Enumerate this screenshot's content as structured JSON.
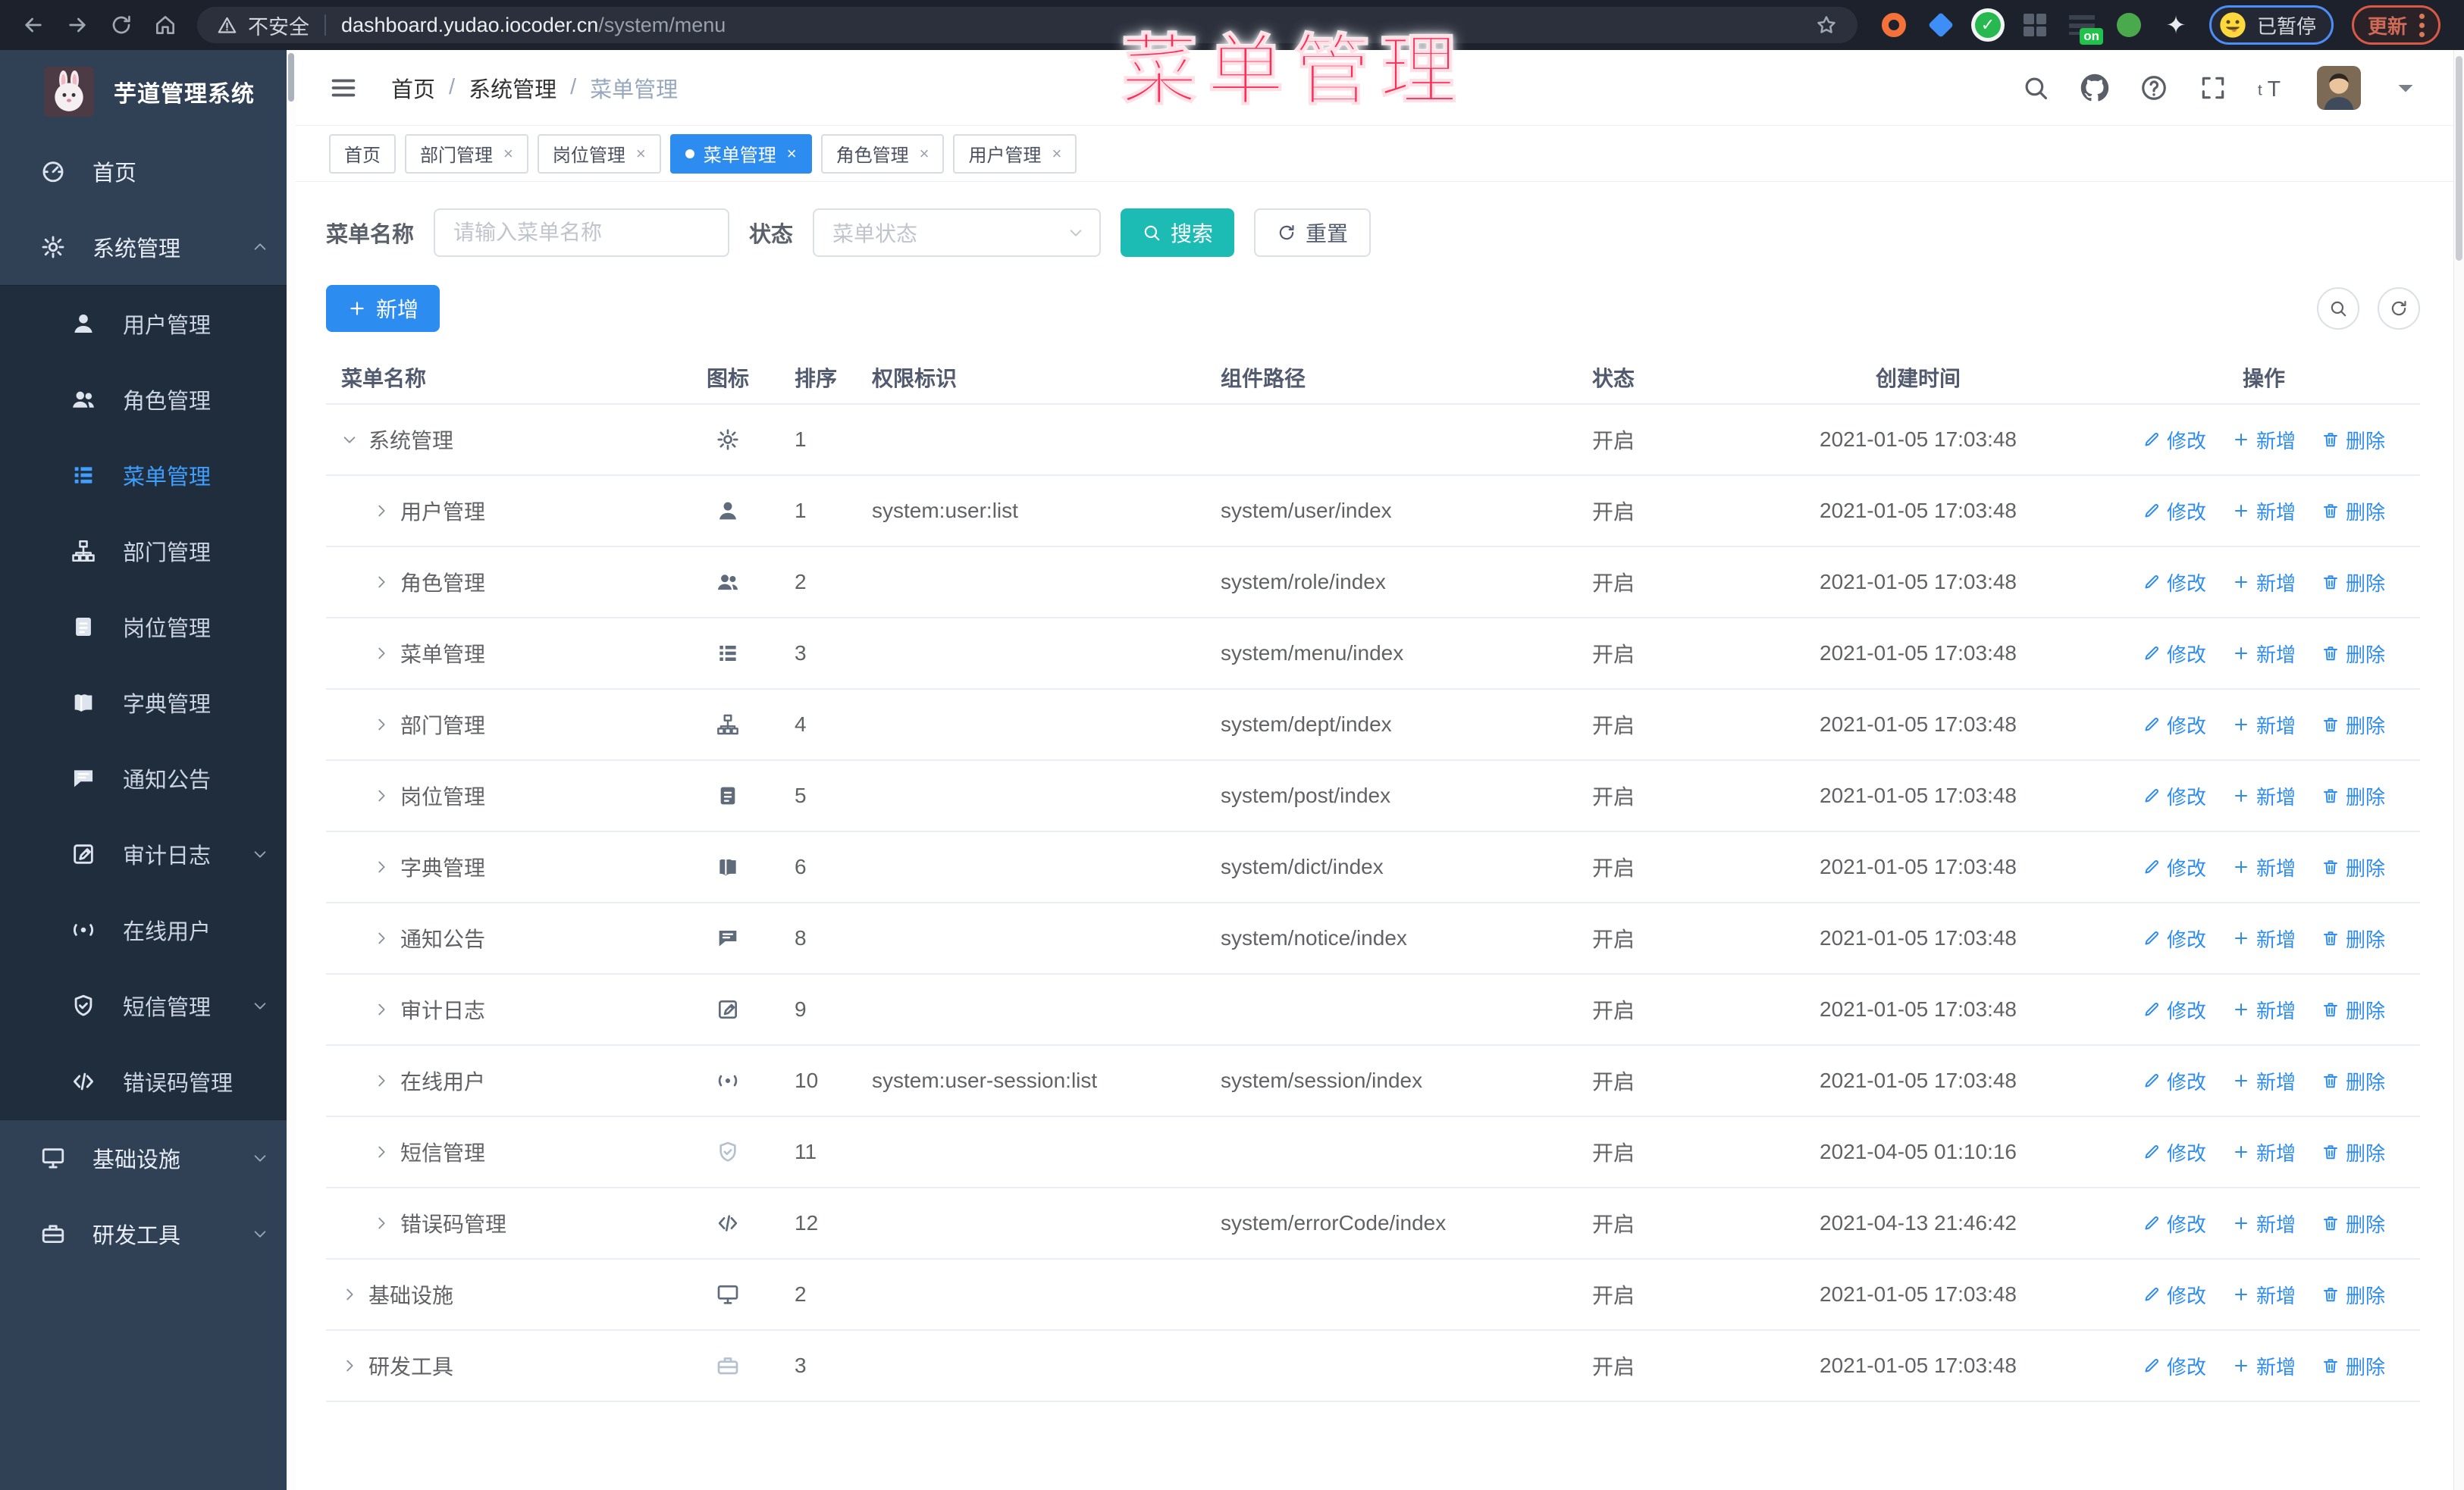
{
  "colors": {
    "accent_blue": "#2d8cf0",
    "link_blue": "#409eff",
    "teal": "#1cbcb4",
    "sidebar_bg": "#304156",
    "submenu_bg": "#1f2d3d",
    "watermark_pink": "#fb2e57",
    "chrome_bg": "#1d212b"
  },
  "watermark": "菜单管理",
  "browser": {
    "security_label": "不安全",
    "url_host": "dashboard.yudao.iocoder.cn",
    "url_path": "/system/menu",
    "extensions": [
      {
        "kind": "ring"
      },
      {
        "kind": "gem"
      },
      {
        "kind": "check"
      },
      {
        "kind": "grid"
      },
      {
        "kind": "bars",
        "badge": "on"
      },
      {
        "kind": "tool"
      },
      {
        "kind": "puzzle"
      }
    ],
    "paused_label": "已暂停",
    "update_label": "更新"
  },
  "sidebar": {
    "title": "芋道管理系统",
    "items": [
      {
        "label": "首页",
        "icon": "dashboard",
        "type": "top"
      },
      {
        "label": "系统管理",
        "icon": "gear",
        "type": "top",
        "arrow": "up"
      },
      {
        "label": "用户管理",
        "icon": "user",
        "type": "sub"
      },
      {
        "label": "角色管理",
        "icon": "users",
        "type": "sub"
      },
      {
        "label": "菜单管理",
        "icon": "menu",
        "type": "sub",
        "active": true
      },
      {
        "label": "部门管理",
        "icon": "tree",
        "type": "sub"
      },
      {
        "label": "岗位管理",
        "icon": "post",
        "type": "sub"
      },
      {
        "label": "字典管理",
        "icon": "dict",
        "type": "sub"
      },
      {
        "label": "通知公告",
        "icon": "notice",
        "type": "sub"
      },
      {
        "label": "审计日志",
        "icon": "audit",
        "type": "sub",
        "arrow": "down"
      },
      {
        "label": "在线用户",
        "icon": "online",
        "type": "sub"
      },
      {
        "label": "短信管理",
        "icon": "sms",
        "type": "sub",
        "arrow": "down"
      },
      {
        "label": "错误码管理",
        "icon": "code",
        "type": "sub"
      },
      {
        "label": "基础设施",
        "icon": "monitor",
        "type": "top",
        "arrow": "down"
      },
      {
        "label": "研发工具",
        "icon": "tool",
        "type": "top",
        "arrow": "down"
      }
    ]
  },
  "navbar": {
    "breadcrumbs": [
      "首页",
      "系统管理",
      "菜单管理"
    ],
    "sep": "/"
  },
  "tabs": [
    {
      "label": "首页"
    },
    {
      "label": "部门管理",
      "closable": true
    },
    {
      "label": "岗位管理",
      "closable": true
    },
    {
      "label": "菜单管理",
      "closable": true,
      "active": true
    },
    {
      "label": "角色管理",
      "closable": true
    },
    {
      "label": "用户管理",
      "closable": true
    }
  ],
  "filters": {
    "name_label": "菜单名称",
    "name_placeholder": "请输入菜单名称",
    "status_label": "状态",
    "status_placeholder": "菜单状态",
    "search_label": "搜索",
    "reset_label": "重置"
  },
  "toolbar": {
    "add_label": "新增"
  },
  "table": {
    "columns": [
      "菜单名称",
      "图标",
      "排序",
      "权限标识",
      "组件路径",
      "状态",
      "创建时间",
      "操作"
    ],
    "action_labels": {
      "edit": "修改",
      "add": "新增",
      "delete": "删除"
    },
    "rows": [
      {
        "name": "系统管理",
        "icon": "gear",
        "level": 0,
        "expanded": true,
        "sort": "1",
        "permission": "",
        "component": "",
        "status": "开启",
        "created": "2021-01-05 17:03:48"
      },
      {
        "name": "用户管理",
        "icon": "user",
        "level": 1,
        "sort": "1",
        "permission": "system:user:list",
        "component": "system/user/index",
        "status": "开启",
        "created": "2021-01-05 17:03:48"
      },
      {
        "name": "角色管理",
        "icon": "users",
        "level": 1,
        "sort": "2",
        "permission": "",
        "component": "system/role/index",
        "status": "开启",
        "created": "2021-01-05 17:03:48"
      },
      {
        "name": "菜单管理",
        "icon": "menu",
        "level": 1,
        "sort": "3",
        "permission": "",
        "component": "system/menu/index",
        "status": "开启",
        "created": "2021-01-05 17:03:48"
      },
      {
        "name": "部门管理",
        "icon": "tree",
        "level": 1,
        "sort": "4",
        "permission": "",
        "component": "system/dept/index",
        "status": "开启",
        "created": "2021-01-05 17:03:48"
      },
      {
        "name": "岗位管理",
        "icon": "post",
        "level": 1,
        "sort": "5",
        "permission": "",
        "component": "system/post/index",
        "status": "开启",
        "created": "2021-01-05 17:03:48"
      },
      {
        "name": "字典管理",
        "icon": "dict",
        "level": 1,
        "sort": "6",
        "permission": "",
        "component": "system/dict/index",
        "status": "开启",
        "created": "2021-01-05 17:03:48"
      },
      {
        "name": "通知公告",
        "icon": "notice",
        "level": 1,
        "sort": "8",
        "permission": "",
        "component": "system/notice/index",
        "status": "开启",
        "created": "2021-01-05 17:03:48"
      },
      {
        "name": "审计日志",
        "icon": "audit",
        "level": 1,
        "sort": "9",
        "permission": "",
        "component": "",
        "status": "开启",
        "created": "2021-01-05 17:03:48"
      },
      {
        "name": "在线用户",
        "icon": "online",
        "level": 1,
        "sort": "10",
        "permission": "system:user-session:list",
        "component": "system/session/index",
        "status": "开启",
        "created": "2021-01-05 17:03:48"
      },
      {
        "name": "短信管理",
        "icon": "sms",
        "level": 1,
        "sort": "11",
        "permission": "",
        "component": "",
        "status": "开启",
        "created": "2021-04-05 01:10:16"
      },
      {
        "name": "错误码管理",
        "icon": "code",
        "level": 1,
        "sort": "12",
        "permission": "",
        "component": "system/errorCode/index",
        "status": "开启",
        "created": "2021-04-13 21:46:42"
      },
      {
        "name": "基础设施",
        "icon": "monitor",
        "level": 0,
        "sort": "2",
        "permission": "",
        "component": "",
        "status": "开启",
        "created": "2021-01-05 17:03:48"
      },
      {
        "name": "研发工具",
        "icon": "tool",
        "level": 0,
        "sort": "3",
        "permission": "",
        "component": "",
        "status": "开启",
        "created": "2021-01-05 17:03:48"
      }
    ]
  }
}
